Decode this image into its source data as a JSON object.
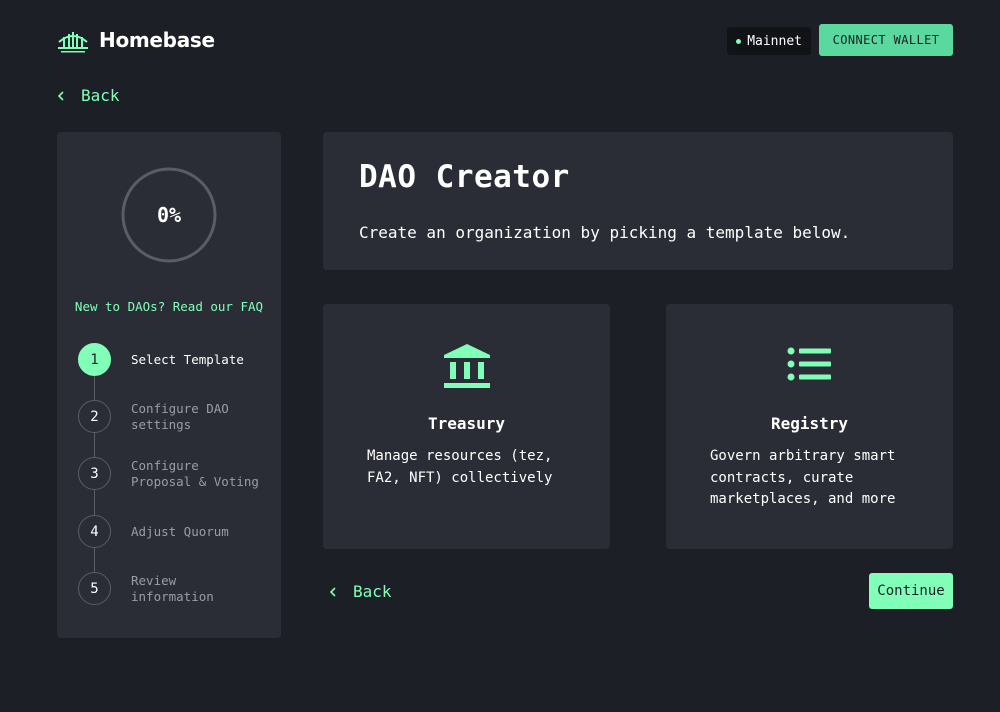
{
  "header": {
    "brand": "Homebase",
    "network": "Mainnet",
    "connect_label": "CONNECT WALLET"
  },
  "top_back_label": "Back",
  "sidebar": {
    "progress": "0%",
    "progress_fraction": 0,
    "faq_link": "New to DAOs? Read our FAQ",
    "steps": [
      {
        "number": "1",
        "label": "Select Template"
      },
      {
        "number": "2",
        "label": "Configure DAO\nsettings"
      },
      {
        "number": "3",
        "label": "Configure\nProposal & Voting"
      },
      {
        "number": "4",
        "label": "Adjust Quorum"
      },
      {
        "number": "5",
        "label": "Review\ninformation"
      }
    ]
  },
  "main": {
    "title": "DAO Creator",
    "subtitle": "Create an organization by picking a template below.",
    "templates": [
      {
        "name": "Treasury",
        "icon": "bank-icon",
        "description": "Manage resources (tez, FA2, NFT) collectively"
      },
      {
        "name": "Registry",
        "icon": "list-icon",
        "description": "Govern arbitrary smart contracts, curate marketplaces, and more"
      }
    ],
    "back_label": "Back",
    "continue_label": "Continue"
  },
  "colors": {
    "background": "#1c1f26",
    "card": "#2a2d35",
    "accent": "#81feb7",
    "connect_button": "#5ad89d"
  }
}
